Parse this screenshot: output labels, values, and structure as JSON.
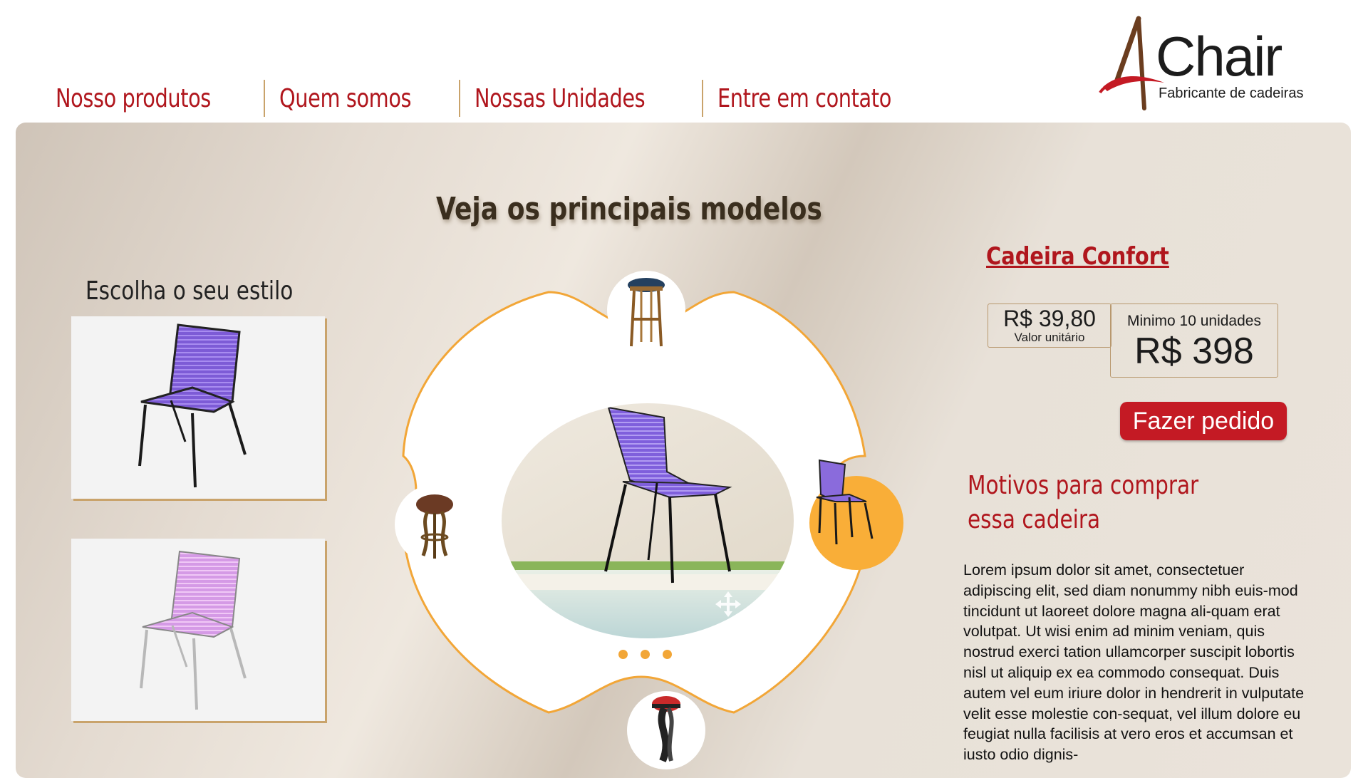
{
  "nav": {
    "items": [
      "Nosso produtos",
      "Quem somos",
      "Nossas Unidades",
      "Entre em contato"
    ]
  },
  "logo": {
    "mark": "4",
    "word": "Chair",
    "tagline": "Fabricante de cadeiras"
  },
  "main": {
    "title": "Veja os principais modelos",
    "style_label": "Escolha o seu estilo",
    "style_options": [
      "purple-chair-black-legs",
      "pink-chair-steel-legs"
    ],
    "carousel": {
      "featured": "purple-chair-poolside",
      "side_items": [
        "tall-wooden-stool",
        "wooden-round-stool",
        "purple-chair",
        "red-bar-stool"
      ],
      "dots": 3
    }
  },
  "product": {
    "name": "Cadeira Confort",
    "unit_price": "R$ 39,80",
    "unit_label": "Valor unitário",
    "min_label": "Minimo 10 unidades",
    "total_price": "R$ 398",
    "order_button": "Fazer pedido",
    "reasons_line1": "Motivos para comprar",
    "reasons_line2": "essa cadeira",
    "description": "Lorem ipsum dolor sit amet, consectetuer adipiscing elit, sed diam nonummy nibh euis-mod tincidunt ut laoreet dolore magna ali-quam erat volutpat. Ut wisi enim ad minim veniam, quis nostrud exerci tation ullamcorper suscipit lobortis nisl ut aliquip ex ea commodo consequat. Duis autem vel eum iriure dolor in hendrerit in vulputate velit esse molestie con-sequat, vel illum dolore eu feugiat nulla facilisis at vero eros et accumsan et iusto odio dignis-"
  },
  "colors": {
    "brand_red": "#b0161d",
    "button_red": "#c41a24",
    "accent_orange": "#f2a637",
    "gold_line": "#c9a36b"
  }
}
